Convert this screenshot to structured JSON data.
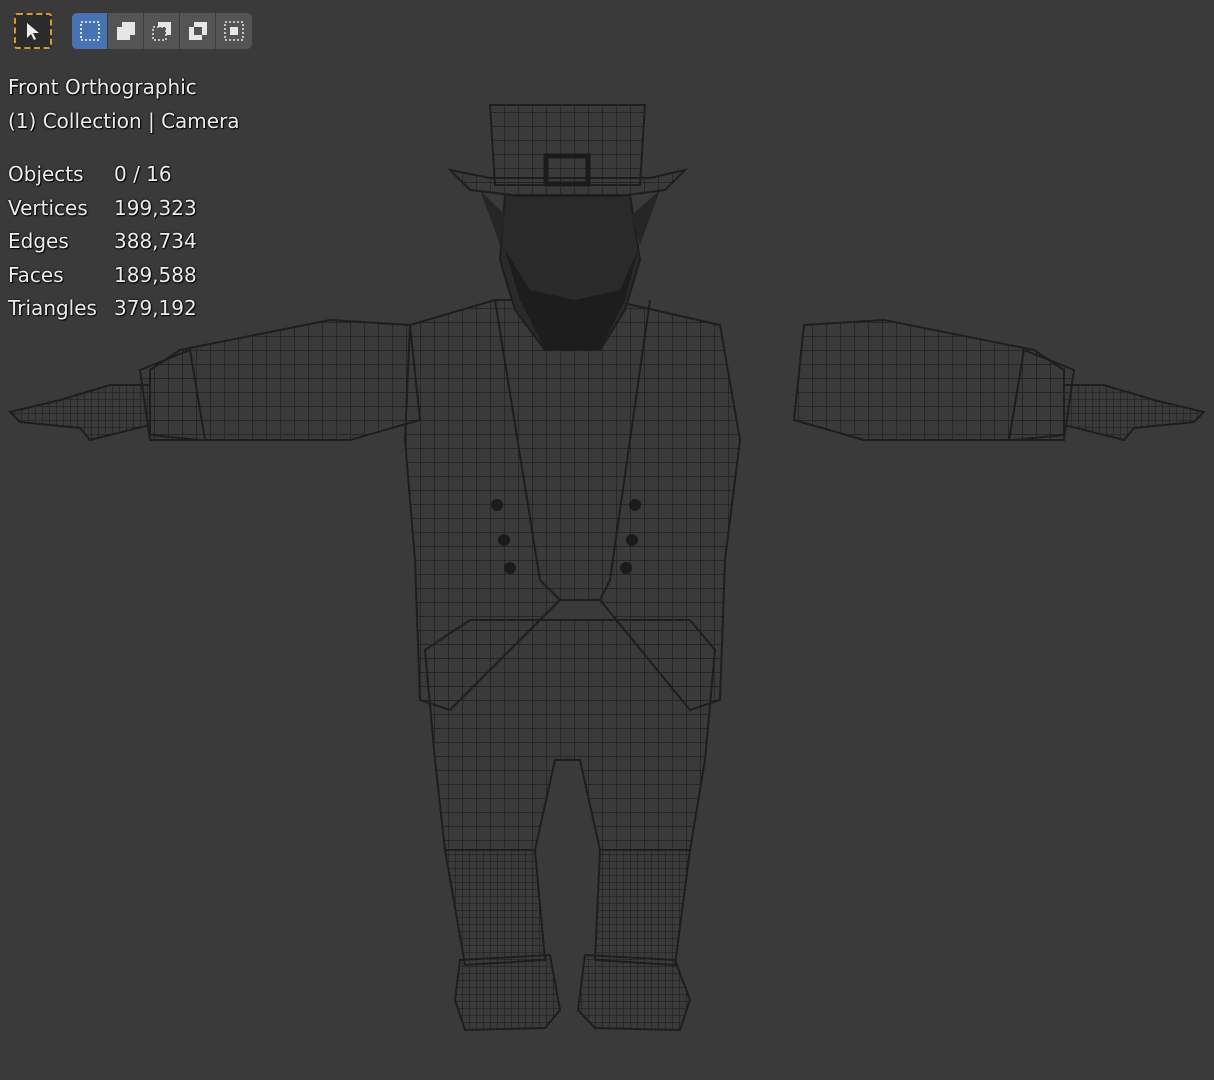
{
  "viewport": {
    "view_name": "Front Orthographic",
    "collection_label": "(1) Collection | Camera",
    "stats": [
      {
        "label": "Objects",
        "value": "0 / 16"
      },
      {
        "label": "Vertices",
        "value": "199,323"
      },
      {
        "label": "Edges",
        "value": "388,734"
      },
      {
        "label": "Faces",
        "value": "189,588"
      },
      {
        "label": "Triangles",
        "value": "379,192"
      }
    ]
  },
  "toolbar": {
    "active_tool_icon": "select-cursor-icon",
    "modes": [
      {
        "icon": "select-box-icon",
        "active": true
      },
      {
        "icon": "extend-selection-icon",
        "active": false
      },
      {
        "icon": "subtract-selection-icon",
        "active": false
      },
      {
        "icon": "invert-selection-icon",
        "active": false
      },
      {
        "icon": "intersect-selection-icon",
        "active": false
      }
    ]
  },
  "colors": {
    "background": "#3a3a3a",
    "active_mode": "#4772b3",
    "tool_outline": "#d69a2a",
    "wire": "#1f1f1f",
    "text": "#ececec"
  }
}
